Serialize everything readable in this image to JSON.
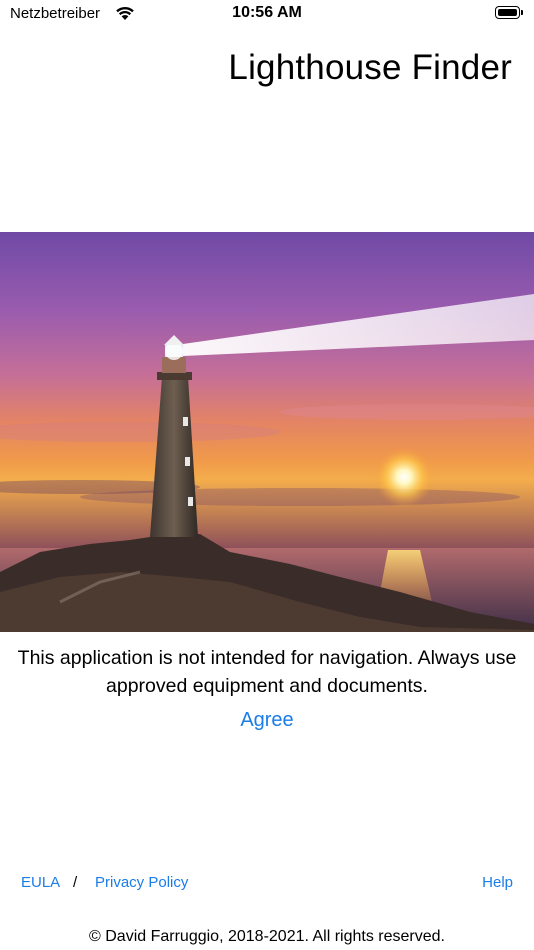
{
  "status_bar": {
    "carrier": "Netzbetreiber",
    "time": "10:56 AM",
    "icons": [
      "wifi-icon",
      "battery-icon"
    ]
  },
  "header": {
    "title": "Lighthouse Finder"
  },
  "hero_image": {
    "subject": "lighthouse-sunset-image"
  },
  "main": {
    "disclaimer": "This application is not intended for navigation. Always use approved equipment and documents.",
    "agree_label": "Agree"
  },
  "footer": {
    "eula_label": "EULA",
    "separator": "/",
    "privacy_label": "Privacy Policy",
    "help_label": "Help",
    "copyright": "© David Farruggio, 2018-2021. All rights reserved."
  },
  "colors": {
    "link": "#1a7de8",
    "background": "#ffffff"
  }
}
